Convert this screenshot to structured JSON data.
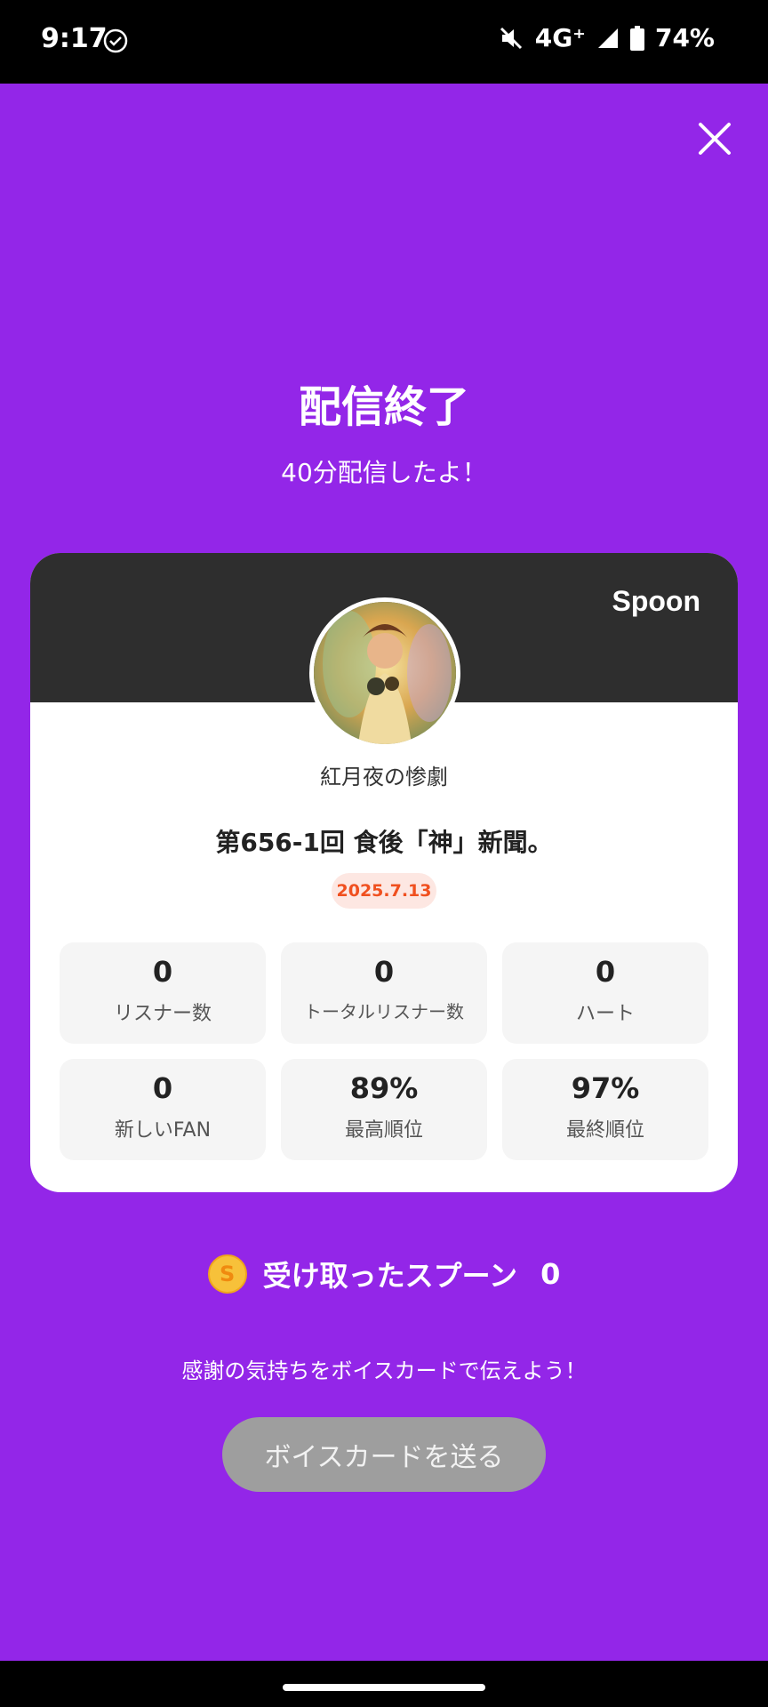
{
  "status_bar": {
    "time": "9:17",
    "network": "4G⁺",
    "battery": "74%",
    "icons": [
      "check-circle-icon",
      "mute-icon",
      "signal-icon",
      "battery-icon"
    ]
  },
  "close_icon": "close-icon",
  "header": {
    "title": "配信終了",
    "subtitle": "40分配信したよ！"
  },
  "card": {
    "brand": "Spoon",
    "username": "紅月夜の惨劇",
    "show_title": "第656-1回 食後「神」新聞。",
    "date": "2025.7.13",
    "stats": [
      {
        "value": "0",
        "label": "リスナー数"
      },
      {
        "value": "0",
        "label": "トータルリスナー数"
      },
      {
        "value": "0",
        "label": "ハート"
      },
      {
        "value": "0",
        "label": "新しいFAN"
      },
      {
        "value": "89%",
        "label": "最高順位"
      },
      {
        "value": "97%",
        "label": "最終順位"
      }
    ]
  },
  "spoons": {
    "coin_symbol": "S",
    "label": "受け取ったスプーン",
    "count": "0"
  },
  "thanks_text": "感謝の気持ちをボイスカードで伝えよう！",
  "voicecard_button": "ボイスカードを送る",
  "colors": {
    "background": "#9326e8",
    "card_header": "#2e2e2e",
    "date_badge_text": "#f0501f",
    "button": "#9e9e9e"
  }
}
